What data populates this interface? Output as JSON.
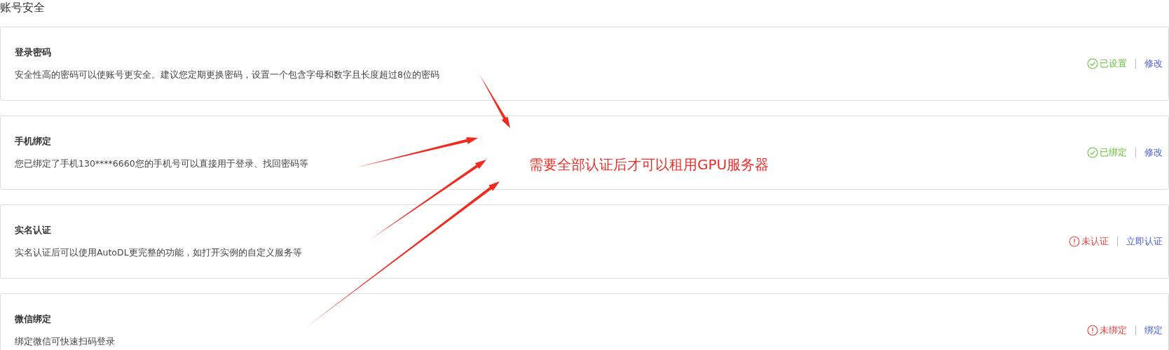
{
  "page_title": "账号安全",
  "items": [
    {
      "title": "登录密码",
      "description": "安全性高的密码可以使账号更安全。建议您定期更换密码，设置一个包含字母和数字且长度超过8位的密码",
      "status": "已设置",
      "verified": true,
      "action": "修改"
    },
    {
      "title": "手机绑定",
      "description": "您已绑定了手机130****6660您的手机号可以直接用于登录、找回密码等",
      "status": "已绑定",
      "verified": true,
      "action": "修改"
    },
    {
      "title": "实名认证",
      "description": "实名认证后可以使用AutoDL更完整的功能，如打开实例的自定义服务等",
      "status": "未认证",
      "verified": false,
      "action": "立即认证"
    },
    {
      "title": "微信绑定",
      "description": "绑定微信可快速扫码登录",
      "status": "未绑定",
      "verified": false,
      "action": "绑定"
    }
  ],
  "annotation": {
    "text": "需要全部认证后才可以租用GPU服务器"
  }
}
